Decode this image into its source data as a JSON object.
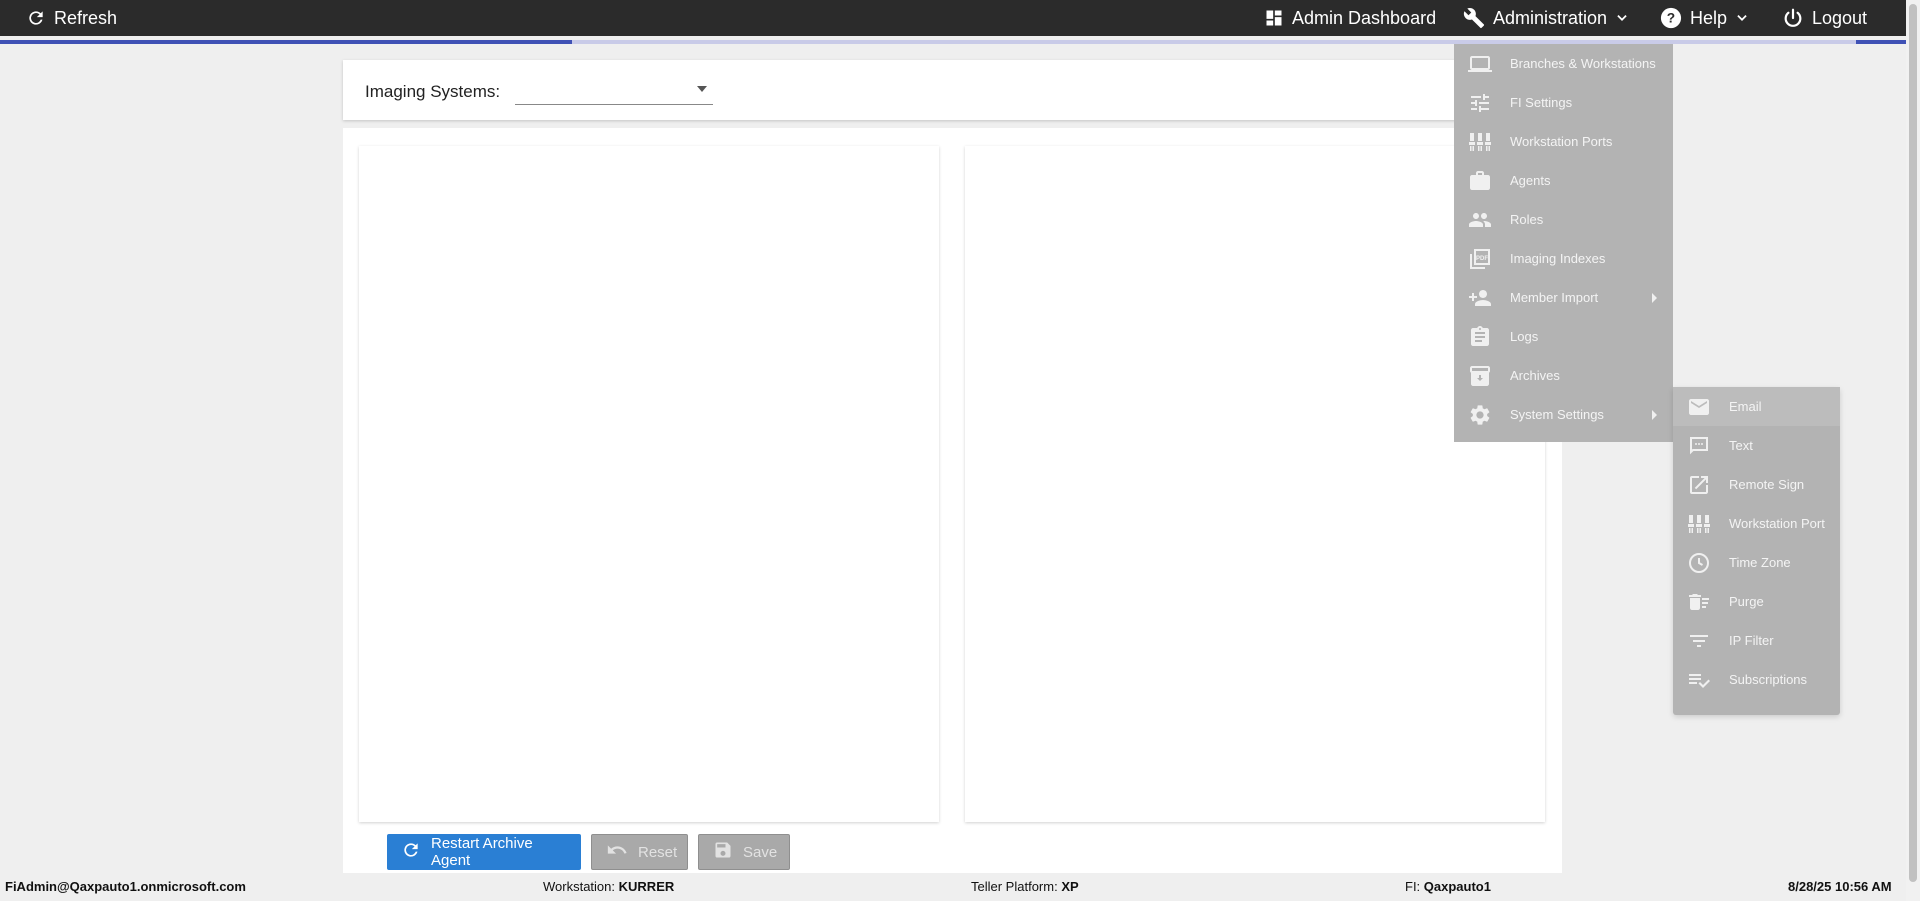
{
  "topbar": {
    "refresh_label": "Refresh",
    "admin_dashboard_label": "Admin Dashboard",
    "administration_label": "Administration",
    "help_label": "Help",
    "logout_label": "Logout"
  },
  "page_load_progress": 0.3,
  "imaging": {
    "label": "Imaging Systems:",
    "selected": ""
  },
  "buttons": {
    "restart_label": "Restart Archive Agent",
    "reset_label": "Reset",
    "save_label": "Save"
  },
  "admin_menu": {
    "items": [
      {
        "label": "Branches & Workstations",
        "icon": "laptop-icon"
      },
      {
        "label": "FI Settings",
        "icon": "tune-icon"
      },
      {
        "label": "Workstation Ports",
        "icon": "ports-icon"
      },
      {
        "label": "Agents",
        "icon": "briefcase-icon"
      },
      {
        "label": "Roles",
        "icon": "people-icon"
      },
      {
        "label": "Imaging Indexes",
        "icon": "pdf-icon"
      },
      {
        "label": "Member Import",
        "icon": "person-add-icon",
        "has_submenu": true
      },
      {
        "label": "Logs",
        "icon": "clipboard-icon"
      },
      {
        "label": "Archives",
        "icon": "archive-icon"
      },
      {
        "label": "System Settings",
        "icon": "gear-icon",
        "has_submenu": true
      }
    ]
  },
  "system_settings_submenu": {
    "items": [
      {
        "label": "Email",
        "icon": "email-icon"
      },
      {
        "label": "Text",
        "icon": "chat-icon"
      },
      {
        "label": "Remote Sign",
        "icon": "open-in-new-icon"
      },
      {
        "label": "Workstation Port",
        "icon": "ports-icon"
      },
      {
        "label": "Time Zone",
        "icon": "clock-icon"
      },
      {
        "label": "Purge",
        "icon": "delete-sweep-icon"
      },
      {
        "label": "IP Filter",
        "icon": "filter-icon"
      },
      {
        "label": "Subscriptions",
        "icon": "playlist-check-icon"
      }
    ]
  },
  "statusbar": {
    "user": "FiAdmin@Qaxpauto1.onmicrosoft.com",
    "workstation_label": "Workstation:",
    "workstation_value": "KURRER",
    "teller_label": "Teller Platform:",
    "teller_value": "XP",
    "fi_label": "FI:",
    "fi_value": "Qaxpauto1",
    "datetime": "8/28/25 10:56 AM"
  }
}
